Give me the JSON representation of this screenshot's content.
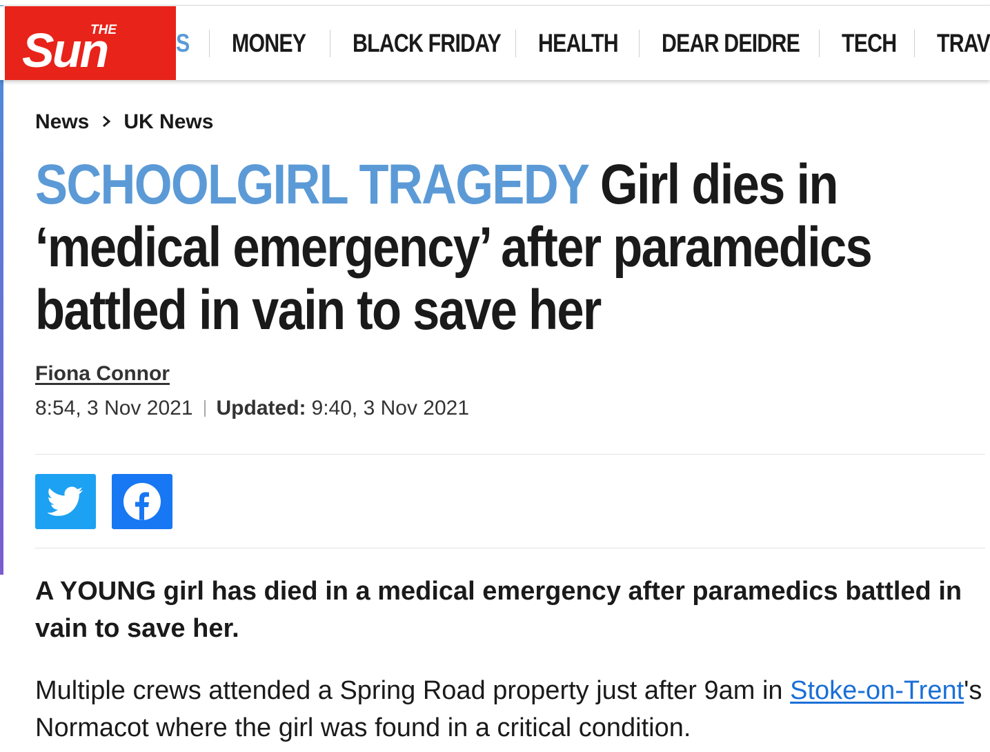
{
  "logo": {
    "line1": "THE",
    "line2": "Sun"
  },
  "nav": {
    "partial_item": "S",
    "items": [
      "MONEY",
      "BLACK FRIDAY",
      "HEALTH",
      "DEAR DEIDRE",
      "TECH",
      "TRAV"
    ]
  },
  "breadcrumb": {
    "items": [
      "News",
      "UK News"
    ]
  },
  "headline": {
    "kicker": "SCHOOLGIRL TRAGEDY",
    "text": "Girl dies in ‘medical emergency’ after paramedics battled in vain to save her"
  },
  "byline": {
    "author": "Fiona Connor",
    "published": "8:54, 3 Nov 2021",
    "updated_label": "Updated:",
    "updated": "9:40, 3 Nov 2021"
  },
  "share": {
    "icons": [
      "twitter-icon",
      "facebook-icon"
    ]
  },
  "article": {
    "lede": "A YOUNG girl has died in a medical emergency after paramedics battled in vain to save her.",
    "para_before_link": "Multiple crews attended a Spring Road property just after 9am in ",
    "link_text": "Stoke-on-Trent",
    "para_after_link": "'s Normacot where the girl was found in a critical condition."
  },
  "colors": {
    "brand_red": "#e8231a",
    "kicker_blue": "#5b9ad6",
    "link_blue": "#1a6fd6",
    "twitter_blue": "#1da1f2",
    "facebook_blue": "#1877f2"
  }
}
